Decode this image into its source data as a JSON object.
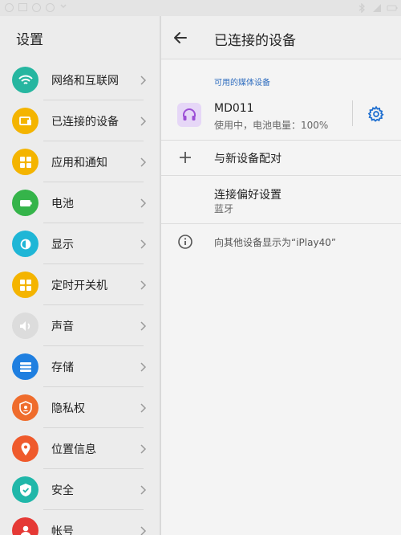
{
  "settings": {
    "title": "设置",
    "items": [
      {
        "label": "网络和互联网",
        "icon": "wifi-icon",
        "color": "#26b6a0"
      },
      {
        "label": "已连接的设备",
        "icon": "connected-devices-icon",
        "color": "#f4b400"
      },
      {
        "label": "应用和通知",
        "icon": "apps-icon",
        "color": "#f4b400"
      },
      {
        "label": "电池",
        "icon": "battery-icon",
        "color": "#35b44a"
      },
      {
        "label": "显示",
        "icon": "brightness-icon",
        "color": "#1fb6d6"
      },
      {
        "label": "定时开关机",
        "icon": "schedule-power-icon",
        "color": "#f4b400"
      },
      {
        "label": "声音",
        "icon": "volume-icon",
        "color": "#dcdcdc"
      },
      {
        "label": "存储",
        "icon": "storage-icon",
        "color": "#1f7fe0"
      },
      {
        "label": "隐私权",
        "icon": "privacy-icon",
        "color": "#ef6c2c"
      },
      {
        "label": "位置信息",
        "icon": "location-icon",
        "color": "#ef5a2c"
      },
      {
        "label": "安全",
        "icon": "security-icon",
        "color": "#20b7a9"
      },
      {
        "label": "帐号",
        "icon": "account-icon",
        "color": "#e53935"
      }
    ]
  },
  "connected": {
    "title": "已连接的设备",
    "section_label": "可用的媒体设备",
    "device": {
      "name": "MD011",
      "status": "使用中，电池电量：100%"
    },
    "pair_label": "与新设备配对",
    "prefs_label": "连接偏好设置",
    "prefs_sub": "蓝牙",
    "visible_label": "向其他设备显示为“iPlay40”"
  },
  "colors": {
    "accent": "#2f6dbf",
    "headset": "#9c4fd6"
  }
}
